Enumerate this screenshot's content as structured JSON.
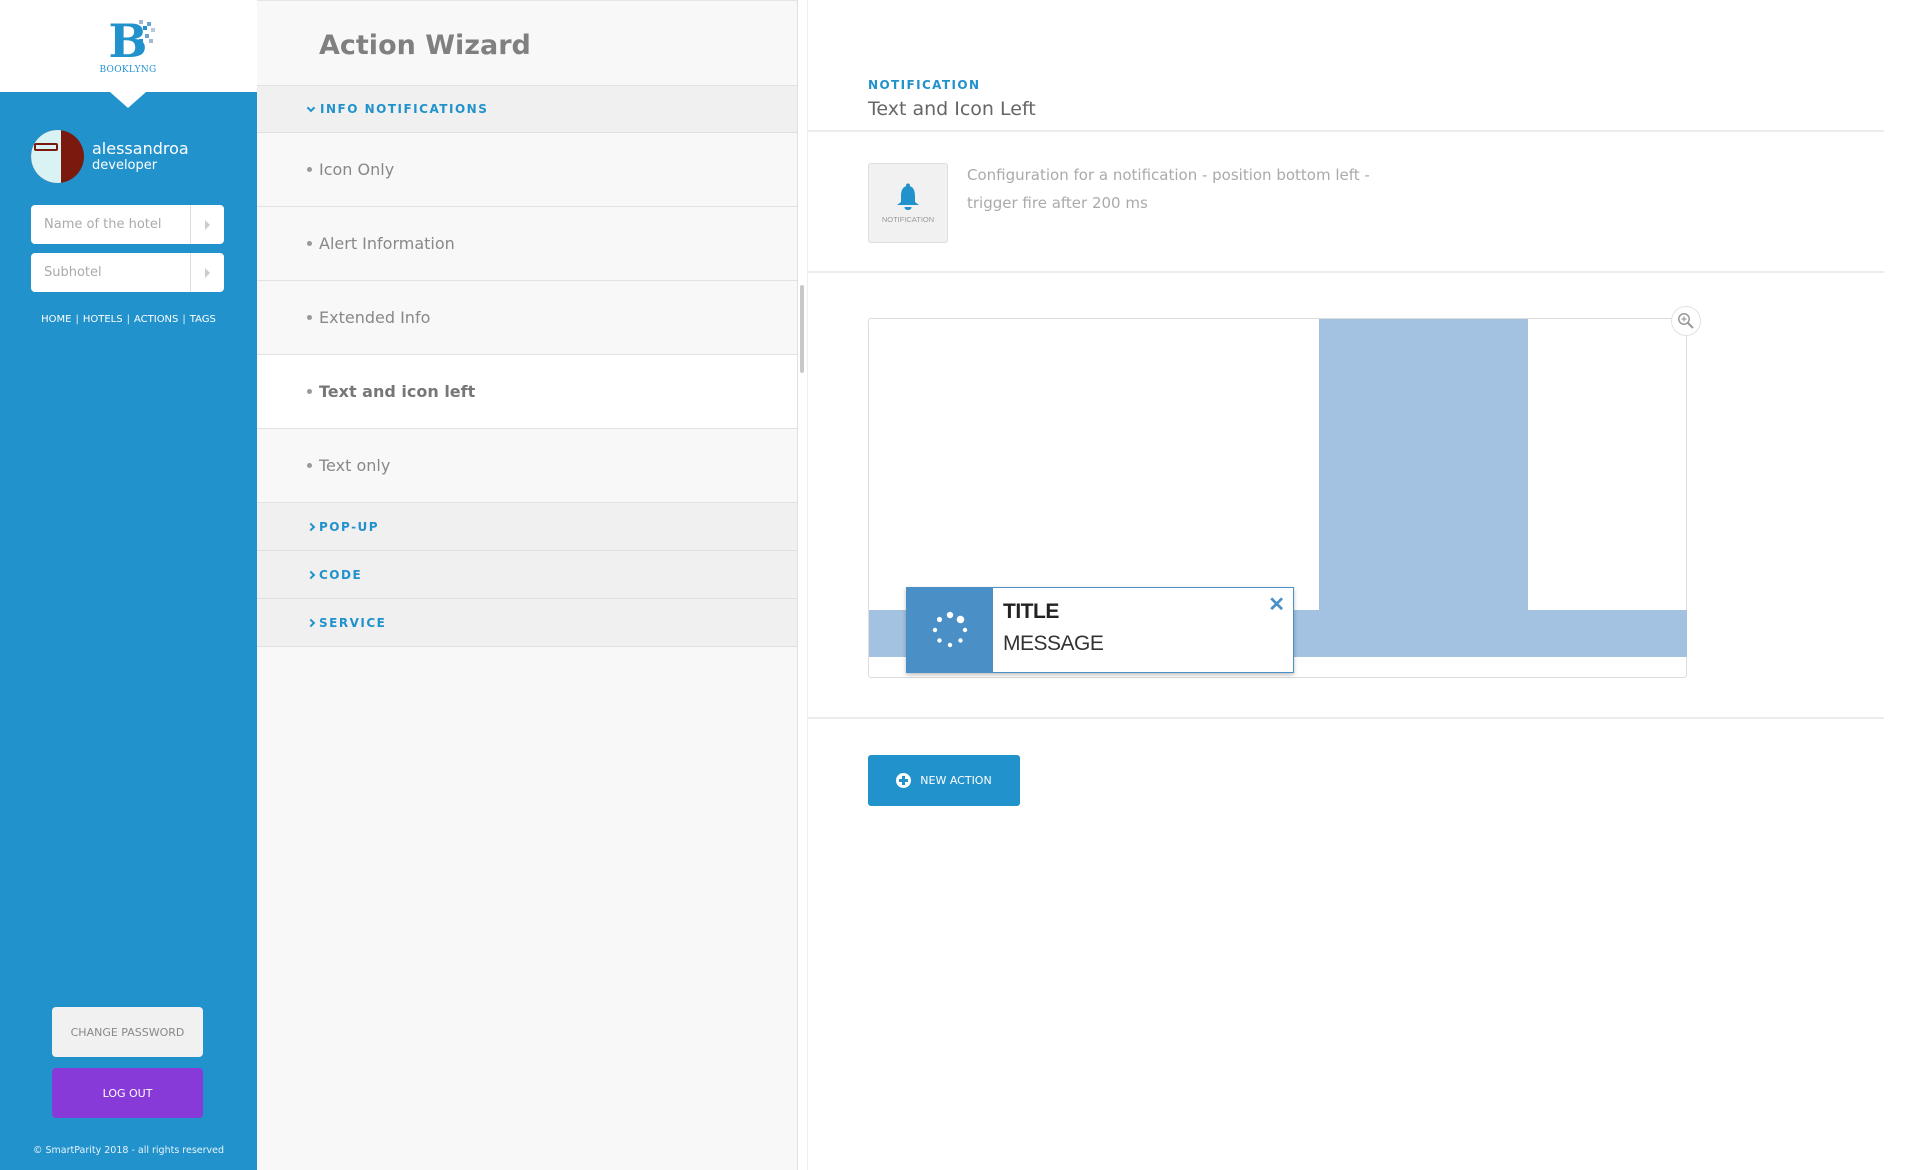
{
  "sidebar": {
    "logo_text": "BOOKLYNG",
    "logo_letter": "B",
    "user": {
      "name": "alessandroa",
      "role": "developer"
    },
    "hotel_field": {
      "placeholder": "Name of the hotel",
      "value": ""
    },
    "subhotel_field": {
      "placeholder": "Subhotel",
      "value": ""
    },
    "nav": [
      {
        "label": "HOME"
      },
      {
        "label": "HOTELS"
      },
      {
        "label": "ACTIONS"
      },
      {
        "label": "TAGS"
      }
    ],
    "nav_separator": "|",
    "change_password_label": "CHANGE PASSWORD",
    "logout_label": "LOG OUT",
    "footer": "© SmartParity 2018 - all rights reserved"
  },
  "wizard": {
    "title": "Action Wizard",
    "sections": [
      {
        "label": "INFO NOTIFICATIONS",
        "expanded": true,
        "items": [
          {
            "label": "Icon Only",
            "active": false
          },
          {
            "label": "Alert Information",
            "active": false
          },
          {
            "label": "Extended Info",
            "active": false
          },
          {
            "label": "Text and icon left",
            "active": true
          },
          {
            "label": "Text only",
            "active": false
          }
        ]
      },
      {
        "label": "POP-UP",
        "expanded": false
      },
      {
        "label": "CODE",
        "expanded": false
      },
      {
        "label": "SERVICE",
        "expanded": false
      }
    ]
  },
  "detail": {
    "kicker": "NOTIFICATION",
    "title": "Text and Icon Left",
    "icon": {
      "name": "bell-icon",
      "label": "NOTIFICATION"
    },
    "description": "Configuration for a notification - position bottom left - trigger fire after 200 ms",
    "preview": {
      "toast_title": "TITLE",
      "toast_message": "MESSAGE",
      "close_glyph": "✕"
    },
    "new_action_label": "NEW ACTION"
  },
  "colors": {
    "brand": "#2192cc",
    "logout": "#883ad8",
    "toast_accent": "#4a90c6",
    "preview_shape": "#a3c2e1"
  }
}
